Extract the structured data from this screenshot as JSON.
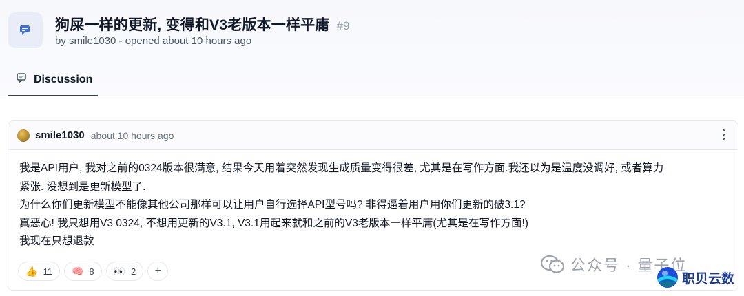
{
  "header": {
    "title": "狗屎一样的更新, 变得和V3老版本一样平庸",
    "issue_number": "#9",
    "meta": "by smile1030 - opened about 10 hours ago"
  },
  "tabs": [
    {
      "label": "Discussion",
      "icon": "discussion-icon",
      "active": true
    }
  ],
  "comment": {
    "author": "smile1030",
    "time": "about 10 hours ago",
    "lines": [
      "我是API用户, 我对之前的0324版本很满意, 结果今天用着突然发现生成质量变得很差, 尤其是在写作方面.我还以为是温度没调好, 或者算力",
      "紧张. 没想到是更新模型了.",
      "为什么你们更新模型不能像其他公司那样可以让用户自行选择API型号吗? 非得逼着用户用你们更新的破3.1?",
      "真恶心! 我只想用V3 0324, 不想用更新的V3.1, V3.1用起来就和之前的V3老版本一样平庸(尤其是在写作方面!)",
      "我现在只想退款"
    ],
    "reactions": [
      {
        "emoji": "👍",
        "icon": "thumbs-up-icon",
        "count": "11"
      },
      {
        "emoji": "🧠",
        "icon": "brain-icon",
        "count": "8"
      },
      {
        "emoji": "👀",
        "icon": "eyes-icon",
        "count": "2"
      }
    ],
    "add_reaction": "+"
  },
  "watermark": {
    "text": "公众号 · 量子位"
  },
  "brand": {
    "text": "职贝云数"
  },
  "colors": {
    "accent": "#2563eb",
    "tab_underline": "#374151",
    "muted": "#6b7280"
  }
}
